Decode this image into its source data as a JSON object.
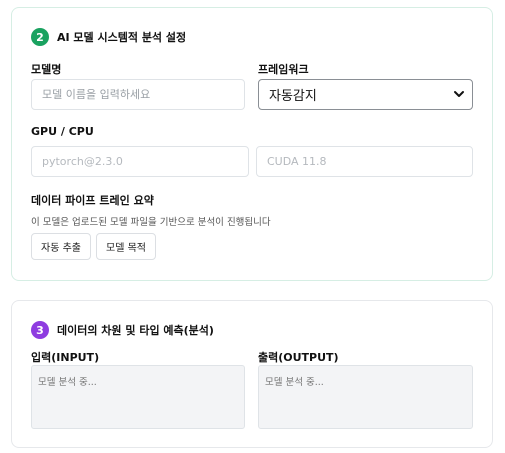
{
  "section1": {
    "step": "2",
    "title": "AI 모델 시스템적 분석 설정",
    "model_name": {
      "label": "모델명",
      "placeholder": "모델 이름을 입력하세요"
    },
    "framework": {
      "label": "프레임워크",
      "selected": "자동감지"
    },
    "gpu_cpu": {
      "label": "GPU / CPU",
      "pytorch_placeholder": "pytorch@2.3.0",
      "cuda_placeholder": "CUDA 11.8"
    },
    "pipeline": {
      "label": "데이터 파이프 트레인 요약",
      "hint": "이 모델은 업로드된 모델 파일을 기반으로 분석이 진행됩니다",
      "auto_extract_button": "자동 추출",
      "model_purpose_button": "모델 목적"
    }
  },
  "section2": {
    "step": "3",
    "title": "데이터의 차원 및 타입 예측(분석)",
    "input": {
      "label": "입력(INPUT)",
      "placeholder": "모델 분석 중..."
    },
    "output": {
      "label": "출력(OUTPUT)",
      "placeholder": "모델 분석 중..."
    }
  },
  "colors": {
    "step2_badge": "#1aa260",
    "step3_badge": "#8e3ce0"
  },
  "icons": {
    "select_caret": "chevron-down-icon"
  }
}
